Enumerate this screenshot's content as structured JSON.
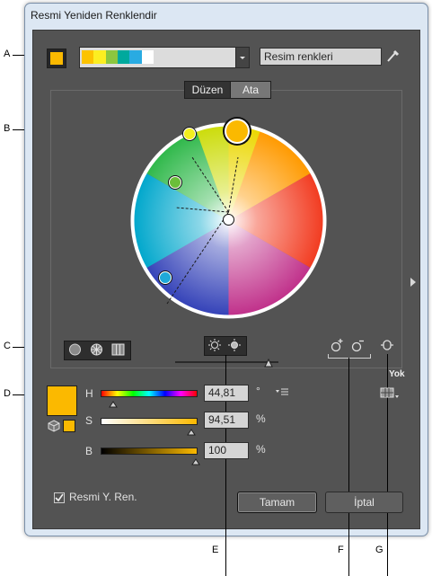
{
  "window": {
    "title": "Resmi Yeniden Renklendir"
  },
  "top": {
    "palette_colors": [
      "#fcc300",
      "#fcee21",
      "#8cc63f",
      "#00a99d",
      "#29abe2",
      "#ffffff"
    ],
    "color_group_field": "Resim renkleri",
    "active_color": "#fbb900"
  },
  "tabs": [
    {
      "label": "Düzen"
    },
    {
      "label": "Ata"
    }
  ],
  "sliders": {
    "H": {
      "label": "H",
      "value": "44,81",
      "unit": "°"
    },
    "S": {
      "label": "S",
      "value": "94,51",
      "unit": "%"
    },
    "B": {
      "label": "B",
      "value": "100",
      "unit": "%"
    }
  },
  "limit": {
    "label": "Yok"
  },
  "footer": {
    "checkbox_label": "Resmi Y. Ren.",
    "ok_label": "Tamam",
    "cancel_label": "İptal"
  },
  "callouts": [
    "A",
    "B",
    "C",
    "D",
    "E",
    "F",
    "G"
  ],
  "icons": {
    "eyedropper": "eyedropper-icon",
    "dropdown": "chevron-down-icon",
    "wheel_smooth": "smooth-wheel-icon",
    "wheel_segmented": "segmented-wheel-icon",
    "color_bars": "color-bars-icon",
    "brightness": "brightness-icon",
    "saturation": "saturation-icon",
    "add_handle": "add-color-icon",
    "remove_handle": "remove-color-icon",
    "link": "link-harmony-icon",
    "expand": "chevron-right-icon",
    "menu": "menu-icon",
    "cube": "cube-icon"
  }
}
